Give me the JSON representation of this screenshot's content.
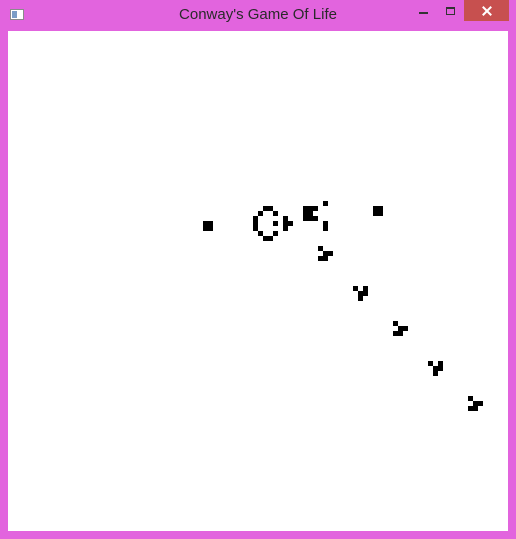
{
  "window": {
    "title": "Conway's Game Of Life",
    "frame_color": "#e264de",
    "close_color": "#c7504f"
  },
  "controls": {
    "icon": "app-icon",
    "minimize": "minimize-icon",
    "maximize": "maximize-icon",
    "close": "close-icon"
  },
  "board": {
    "background": "#ffffff",
    "cell_color": "#000000",
    "cell_unit": 5,
    "live_cells": [
      [
        39,
        38
      ],
      [
        40,
        38
      ],
      [
        39,
        39
      ],
      [
        40,
        39
      ],
      [
        51,
        35
      ],
      [
        52,
        35
      ],
      [
        50,
        36
      ],
      [
        53,
        36
      ],
      [
        49,
        37
      ],
      [
        55,
        37
      ],
      [
        49,
        38
      ],
      [
        53,
        38
      ],
      [
        55,
        38
      ],
      [
        56,
        38
      ],
      [
        49,
        39
      ],
      [
        55,
        39
      ],
      [
        50,
        40
      ],
      [
        53,
        40
      ],
      [
        51,
        41
      ],
      [
        52,
        41
      ],
      [
        63,
        34
      ],
      [
        59,
        35
      ],
      [
        60,
        35
      ],
      [
        61,
        35
      ],
      [
        59,
        36
      ],
      [
        60,
        36
      ],
      [
        59,
        37
      ],
      [
        60,
        37
      ],
      [
        61,
        37
      ],
      [
        63,
        38
      ],
      [
        63,
        39
      ],
      [
        73,
        35
      ],
      [
        74,
        35
      ],
      [
        73,
        36
      ],
      [
        74,
        36
      ],
      [
        62,
        43
      ],
      [
        63,
        44
      ],
      [
        64,
        44
      ],
      [
        62,
        45
      ],
      [
        63,
        45
      ],
      [
        69,
        51
      ],
      [
        71,
        51
      ],
      [
        70,
        52
      ],
      [
        71,
        52
      ],
      [
        70,
        53
      ],
      [
        77,
        58
      ],
      [
        78,
        59
      ],
      [
        79,
        59
      ],
      [
        77,
        60
      ],
      [
        78,
        60
      ],
      [
        84,
        66
      ],
      [
        86,
        66
      ],
      [
        85,
        67
      ],
      [
        86,
        67
      ],
      [
        85,
        68
      ],
      [
        92,
        73
      ],
      [
        93,
        74
      ],
      [
        94,
        74
      ],
      [
        92,
        75
      ],
      [
        93,
        75
      ]
    ]
  }
}
